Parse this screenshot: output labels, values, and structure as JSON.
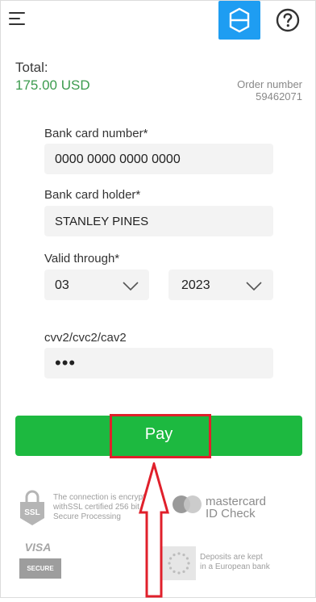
{
  "header": {
    "menu_icon": "hamburger-menu-icon",
    "logo_icon": "shield-logo-icon",
    "help_icon": "question-mark-icon",
    "accent_color": "#1e9df2"
  },
  "summary": {
    "total_label": "Total:",
    "total_amount": "175.00 USD",
    "order_label": "Order number",
    "order_number": "59462071",
    "amount_color": "#3c9b4e"
  },
  "form": {
    "card_number_label": "Bank card number*",
    "card_number_value": "0000 0000 0000 0000",
    "card_holder_label": "Bank card holder*",
    "card_holder_value": "STANLEY PINES",
    "valid_label": "Valid through*",
    "month_value": "03",
    "year_value": "2023",
    "cvv_label": "cvv2/cvc2/cav2",
    "cvv_value": "•••"
  },
  "pay": {
    "label": "Pay",
    "button_color": "#1db940",
    "highlight_color": "#e0202b"
  },
  "footer": {
    "ssl_badge": "SSL",
    "ssl_text_1": "The connection is encrypted",
    "ssl_text_2": "withSSL certified 256 bit",
    "ssl_text_3": "Secure Processing",
    "mastercard_1": "mastercard",
    "mastercard_2": "ID Check",
    "visa_1": "VISA",
    "visa_2": "SECURE",
    "eu_text_1": "Deposits are kept",
    "eu_text_2": "in a European bank"
  }
}
